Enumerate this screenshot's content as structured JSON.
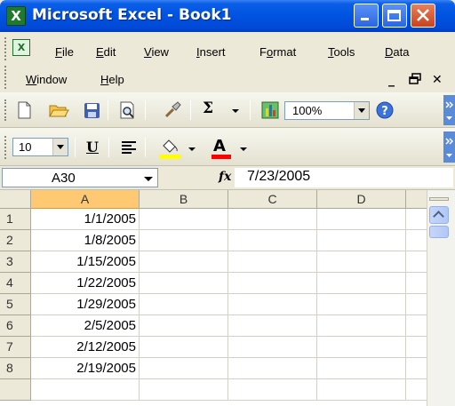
{
  "window": {
    "title": "Microsoft Excel - Book1",
    "icon": "excel-icon",
    "controls": [
      "minimize-icon",
      "restore-icon",
      "close-icon"
    ]
  },
  "menubar": {
    "items": [
      {
        "label": "File",
        "key": "F"
      },
      {
        "label": "Edit",
        "key": "E"
      },
      {
        "label": "View",
        "key": "V"
      },
      {
        "label": "Insert",
        "key": "I"
      },
      {
        "label": "Format",
        "key": "o"
      },
      {
        "label": "Tools",
        "key": "T"
      },
      {
        "label": "Data",
        "key": "D"
      },
      {
        "label": "Window",
        "key": "W"
      },
      {
        "label": "Help",
        "key": "H"
      }
    ],
    "doc_controls": [
      "_",
      "🗗",
      "✕"
    ]
  },
  "standard_toolbar": {
    "buttons": [
      "new-icon",
      "open-icon",
      "save-icon",
      "print-preview-icon",
      "format-painter-icon",
      "autosum-icon",
      "chart-wizard-icon",
      "help-icon"
    ],
    "autosum_label": "Σ",
    "zoom": "100%"
  },
  "formatting_toolbar": {
    "font_size": "10",
    "underline_label": "U",
    "buttons": [
      "align-left-icon",
      "fill-color-icon",
      "font-color-icon"
    ],
    "font_color_label": "A",
    "fill_color": "#ffff00",
    "font_color": "#ff0000"
  },
  "formula_bar": {
    "name_box": "A30",
    "fx_label": "fx",
    "formula": "7/23/2005"
  },
  "grid": {
    "columns": [
      "A",
      "B",
      "C",
      "D"
    ],
    "selected_column": "A",
    "rows": [
      {
        "num": "1",
        "a": "1/1/2005"
      },
      {
        "num": "2",
        "a": "1/8/2005"
      },
      {
        "num": "3",
        "a": "1/15/2005"
      },
      {
        "num": "4",
        "a": "1/22/2005"
      },
      {
        "num": "5",
        "a": "1/29/2005"
      },
      {
        "num": "6",
        "a": "2/5/2005"
      },
      {
        "num": "7",
        "a": "2/12/2005"
      },
      {
        "num": "8",
        "a": "2/19/2005"
      }
    ]
  },
  "colors": {
    "titlebar": "#0053e1",
    "chrome": "#ece9d8",
    "selected_header": "#ffc873",
    "grid_lines": "#d4d0c8"
  }
}
